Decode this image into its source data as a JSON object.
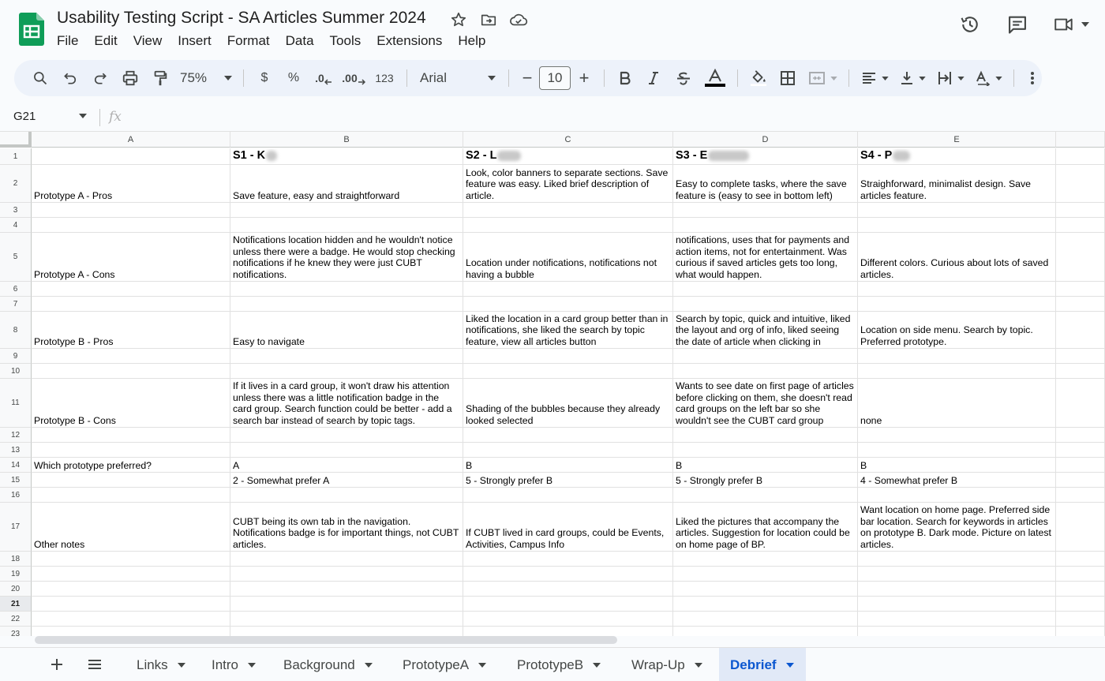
{
  "doc": {
    "title": "Usability Testing Script - SA Articles Summer 2024"
  },
  "menu": [
    "File",
    "Edit",
    "View",
    "Insert",
    "Format",
    "Data",
    "Tools",
    "Extensions",
    "Help"
  ],
  "toolbar": {
    "zoom": "75%",
    "currency": "$",
    "percent": "%",
    "decrease_decimal": ".0",
    "increase_decimal": ".00",
    "number_format": "123",
    "font": "Arial",
    "font_size": "10",
    "minus": "−",
    "plus": "+"
  },
  "formula_bar": {
    "cell_ref": "G21",
    "fx": "fx"
  },
  "columns": [
    "A",
    "B",
    "C",
    "D",
    "E"
  ],
  "rows": [
    "1",
    "2",
    "3",
    "4",
    "5",
    "6",
    "7",
    "8",
    "9",
    "10",
    "11",
    "12",
    "13",
    "14",
    "15",
    "16",
    "17",
    "18",
    "19",
    "20",
    "21",
    "22",
    "23"
  ],
  "selected_row": "21",
  "headers": [
    "S1 - K",
    "S2 - L",
    "S3 - E",
    "S4 - P"
  ],
  "cells": {
    "a2": "Prototype A - Pros",
    "b2": "Save feature, easy and straightforward",
    "c2": "Look, color banners to separate sections. Save feature was easy. Liked brief description of article.",
    "d2": "Easy to complete tasks, where the save feature is (easy to see in bottom left)",
    "e2": "Straighforward, minimalist design. Save articles feature.",
    "a5": "Prototype A - Cons",
    "b5": "Notifications location hidden and he wouldn't notice unless there were a badge. He would stop checking notifications if he knew they were just CUBT notifications.",
    "c5": "Location under notifications, notifications not having a bubble",
    "d5": "Didn't think she could find it in notifications, uses that for payments and action items, not for entertainment. Was curious if saved articles gets too long, what would happen.",
    "e5": "Different colors. Curious about lots of saved articles.",
    "a8": "Prototype B - Pros",
    "b8": "Easy to navigate",
    "c8": "Liked the location in a card group better than in notifications, she liked the search by topic feature, view all articles button",
    "d8": "Search by topic, quick and intuitive, liked the layout and org of info, liked seeing the date of article when clicking in",
    "e8": "Location on side menu. Search by topic. Preferred prototype.",
    "a11": "Prototype B - Cons",
    "b11": "If it lives in a card group, it won't draw his attention unless there was a little notification badge in the card group. Search function could be better - add a search bar instead of search by topic tags.",
    "c11": "Shading of the bubbles because they already looked selected",
    "d11": "Wants to see date on first page of articles before clicking on them, she doesn't read card groups on the left bar so she wouldn't see the CUBT card group",
    "e11": "none",
    "a14": "Which prototype preferred?",
    "b14": "A",
    "c14": "B",
    "d14": "B",
    "e14": "B",
    "b15": "2 - Somewhat prefer A",
    "c15": "5 - Strongly prefer B",
    "d15": "5 - Strongly prefer B",
    "e15": "4 - Somewhat prefer B",
    "a17": "Other notes",
    "b17": "CUBT being its own tab in the navigation. Notifications badge is for important things, not CUBT articles.",
    "c17": "If CUBT lived in card groups, could be Events, Activities, Campus Info",
    "d17": "Liked the pictures that accompany the articles. Suggestion for location could be on home page of BP.",
    "e17": "Want location on home page. Preferred side bar location. Search for keywords in articles on prototype B. Dark mode. Picture on latest articles."
  },
  "tabs": [
    "Links",
    "Intro",
    "Background",
    "PrototypeA",
    "PrototypeB",
    "Wrap-Up",
    "Debrief"
  ],
  "active_tab": "Debrief",
  "colors": {
    "accent": "#0b57d0",
    "sheets_green": "#0f9d58",
    "toolbar_bg": "#edf2fa"
  }
}
